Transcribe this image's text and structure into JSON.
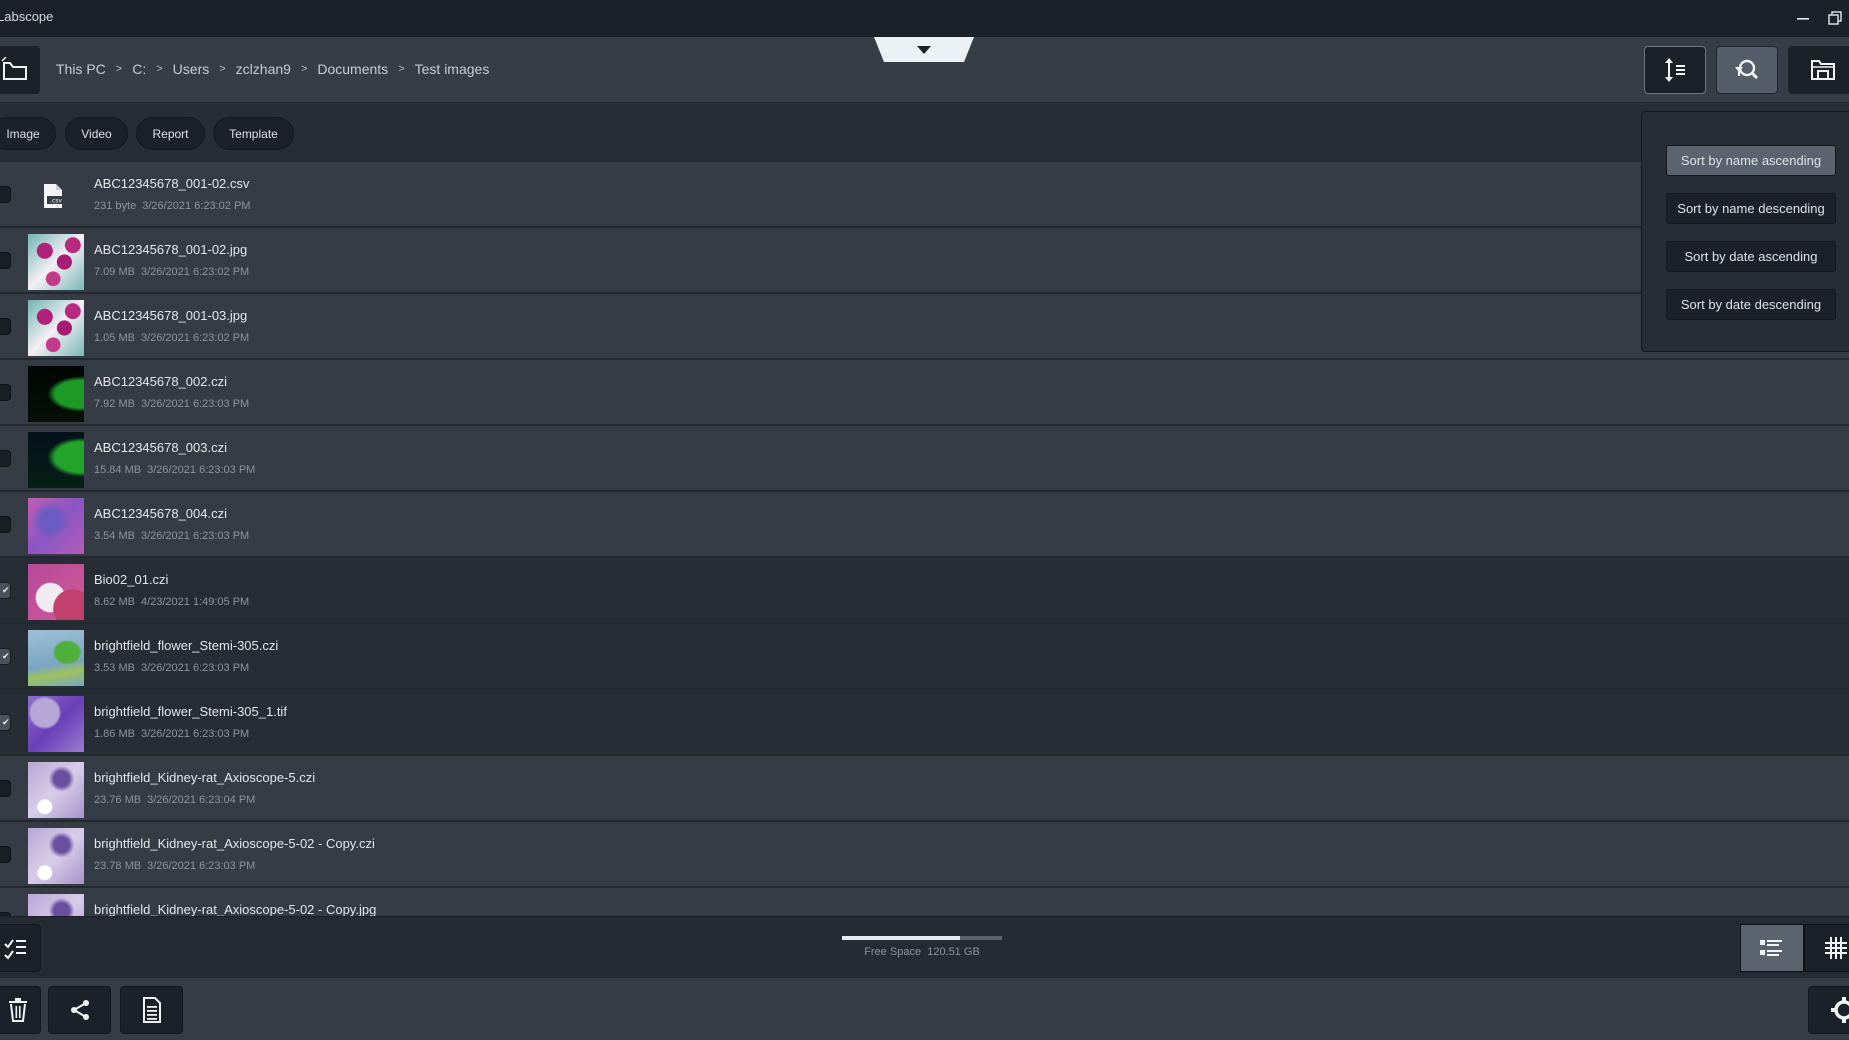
{
  "app": {
    "title": "Labscope"
  },
  "window_controls": {
    "minimize_icon": "minimize-icon",
    "restore_icon": "restore-icon"
  },
  "header": {
    "back_icon": "folder-up-icon",
    "breadcrumb": [
      "This PC",
      "C:",
      "Users",
      "zclzhan9",
      "Documents",
      "Test images"
    ],
    "separator": ">",
    "drawer_icon": "chevron-down-icon",
    "buttons": [
      {
        "name": "sort",
        "icon": "sort-icon",
        "active": true
      },
      {
        "name": "filter-search",
        "icon": "filter-search-icon",
        "active": false
      },
      {
        "name": "folder",
        "icon": "folder-icon",
        "active": false
      }
    ]
  },
  "filters": {
    "chips": [
      "Image",
      "Video",
      "Report",
      "Template"
    ]
  },
  "sort_menu": {
    "options": [
      "Sort by name ascending",
      "Sort by name descending",
      "Sort by date ascending",
      "Sort by date descending"
    ],
    "selected_index": 0
  },
  "files": [
    {
      "name": "ABC12345678_001-02.csv",
      "size": "231 byte",
      "date": "3/26/2021 6:23:02 PM",
      "checked": false,
      "thumb": "csv"
    },
    {
      "name": "ABC12345678_001-02.jpg",
      "size": "7.09 MB",
      "date": "3/26/2021 6:23:02 PM",
      "checked": false,
      "thumb": "stain-pink-teal"
    },
    {
      "name": "ABC12345678_001-03.jpg",
      "size": "1.05 MB",
      "date": "3/26/2021 6:23:02 PM",
      "checked": false,
      "thumb": "stain-pink-teal"
    },
    {
      "name": "ABC12345678_002.czi",
      "size": "7.92 MB",
      "date": "3/26/2021 6:23:03 PM",
      "checked": false,
      "thumb": "fluor-green"
    },
    {
      "name": "ABC12345678_003.czi",
      "size": "15.84 MB",
      "date": "3/26/2021 6:23:03 PM",
      "checked": false,
      "thumb": "fluor-green-blue"
    },
    {
      "name": "ABC12345678_004.czi",
      "size": "3.54 MB",
      "date": "3/26/2021 6:23:03 PM",
      "checked": false,
      "thumb": "tissue-purple"
    },
    {
      "name": "Bio02_01.czi",
      "size": "8.62 MB",
      "date": "4/23/2021 1:49:05 PM",
      "checked": true,
      "thumb": "tissue-section"
    },
    {
      "name": "brightfield_flower_Stemi-305.czi",
      "size": "3.53 MB",
      "date": "3/26/2021 6:23:03 PM",
      "checked": true,
      "thumb": "flower-bud"
    },
    {
      "name": "brightfield_flower_Stemi-305_1.tif",
      "size": "1.86 MB",
      "date": "3/26/2021 6:23:03 PM",
      "checked": true,
      "thumb": "flower-violet"
    },
    {
      "name": "brightfield_Kidney-rat_Axioscope-5.czi",
      "size": "23.76 MB",
      "date": "3/26/2021 6:23:04 PM",
      "checked": false,
      "thumb": "kidney"
    },
    {
      "name": "brightfield_Kidney-rat_Axioscope-5-02 - Copy.czi",
      "size": "23.78 MB",
      "date": "3/26/2021 6:23:03 PM",
      "checked": false,
      "thumb": "kidney"
    },
    {
      "name": "brightfield_Kidney-rat_Axioscope-5-02 - Copy.jpg",
      "size": "",
      "date": "",
      "checked": false,
      "thumb": "kidney"
    }
  ],
  "footer": {
    "select_icon": "checklist-icon",
    "free_space_label": "Free Space",
    "free_space_value": "120.51 GB",
    "used_fraction": 0.74,
    "view_modes": [
      {
        "name": "list",
        "icon": "list-view-icon",
        "active": true
      },
      {
        "name": "grid",
        "icon": "grid-view-icon",
        "active": false
      }
    ],
    "actions": [
      {
        "name": "delete",
        "icon": "trash-icon"
      },
      {
        "name": "share",
        "icon": "share-icon"
      },
      {
        "name": "report",
        "icon": "document-icon"
      }
    ],
    "settings_icon": "gear-icon"
  }
}
